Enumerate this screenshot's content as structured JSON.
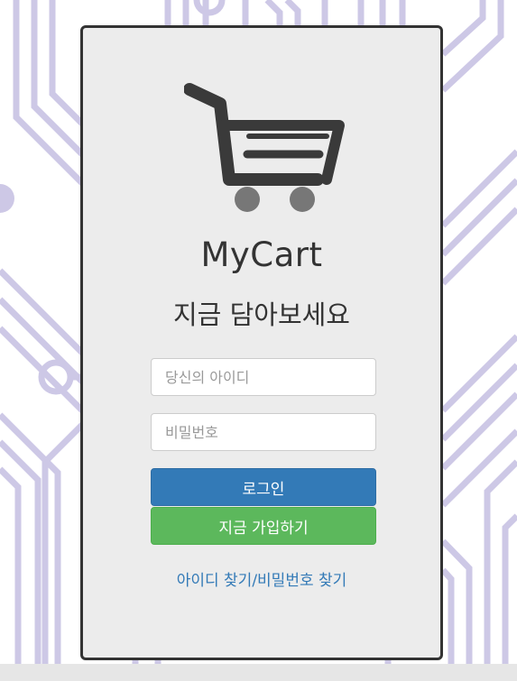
{
  "brand": {
    "name": "MyCart",
    "tagline": "지금 담아보세요",
    "logo_icon": "shopping-cart-icon"
  },
  "login_form": {
    "id_placeholder": "당신의 아이디",
    "id_value": "",
    "password_placeholder": "비밀번호",
    "password_value": "",
    "login_label": "로그인",
    "signup_label": "지금 가입하기"
  },
  "links": {
    "find_id": "아이디 찾기",
    "separator": "/",
    "find_password": "비밀번호 찾기"
  },
  "colors": {
    "card_background": "#ececec",
    "card_border": "#333333",
    "login_button": "#337ab7",
    "signup_button": "#5cb85c",
    "link": "#337ab7",
    "background_pattern": "#cdc8e6"
  }
}
